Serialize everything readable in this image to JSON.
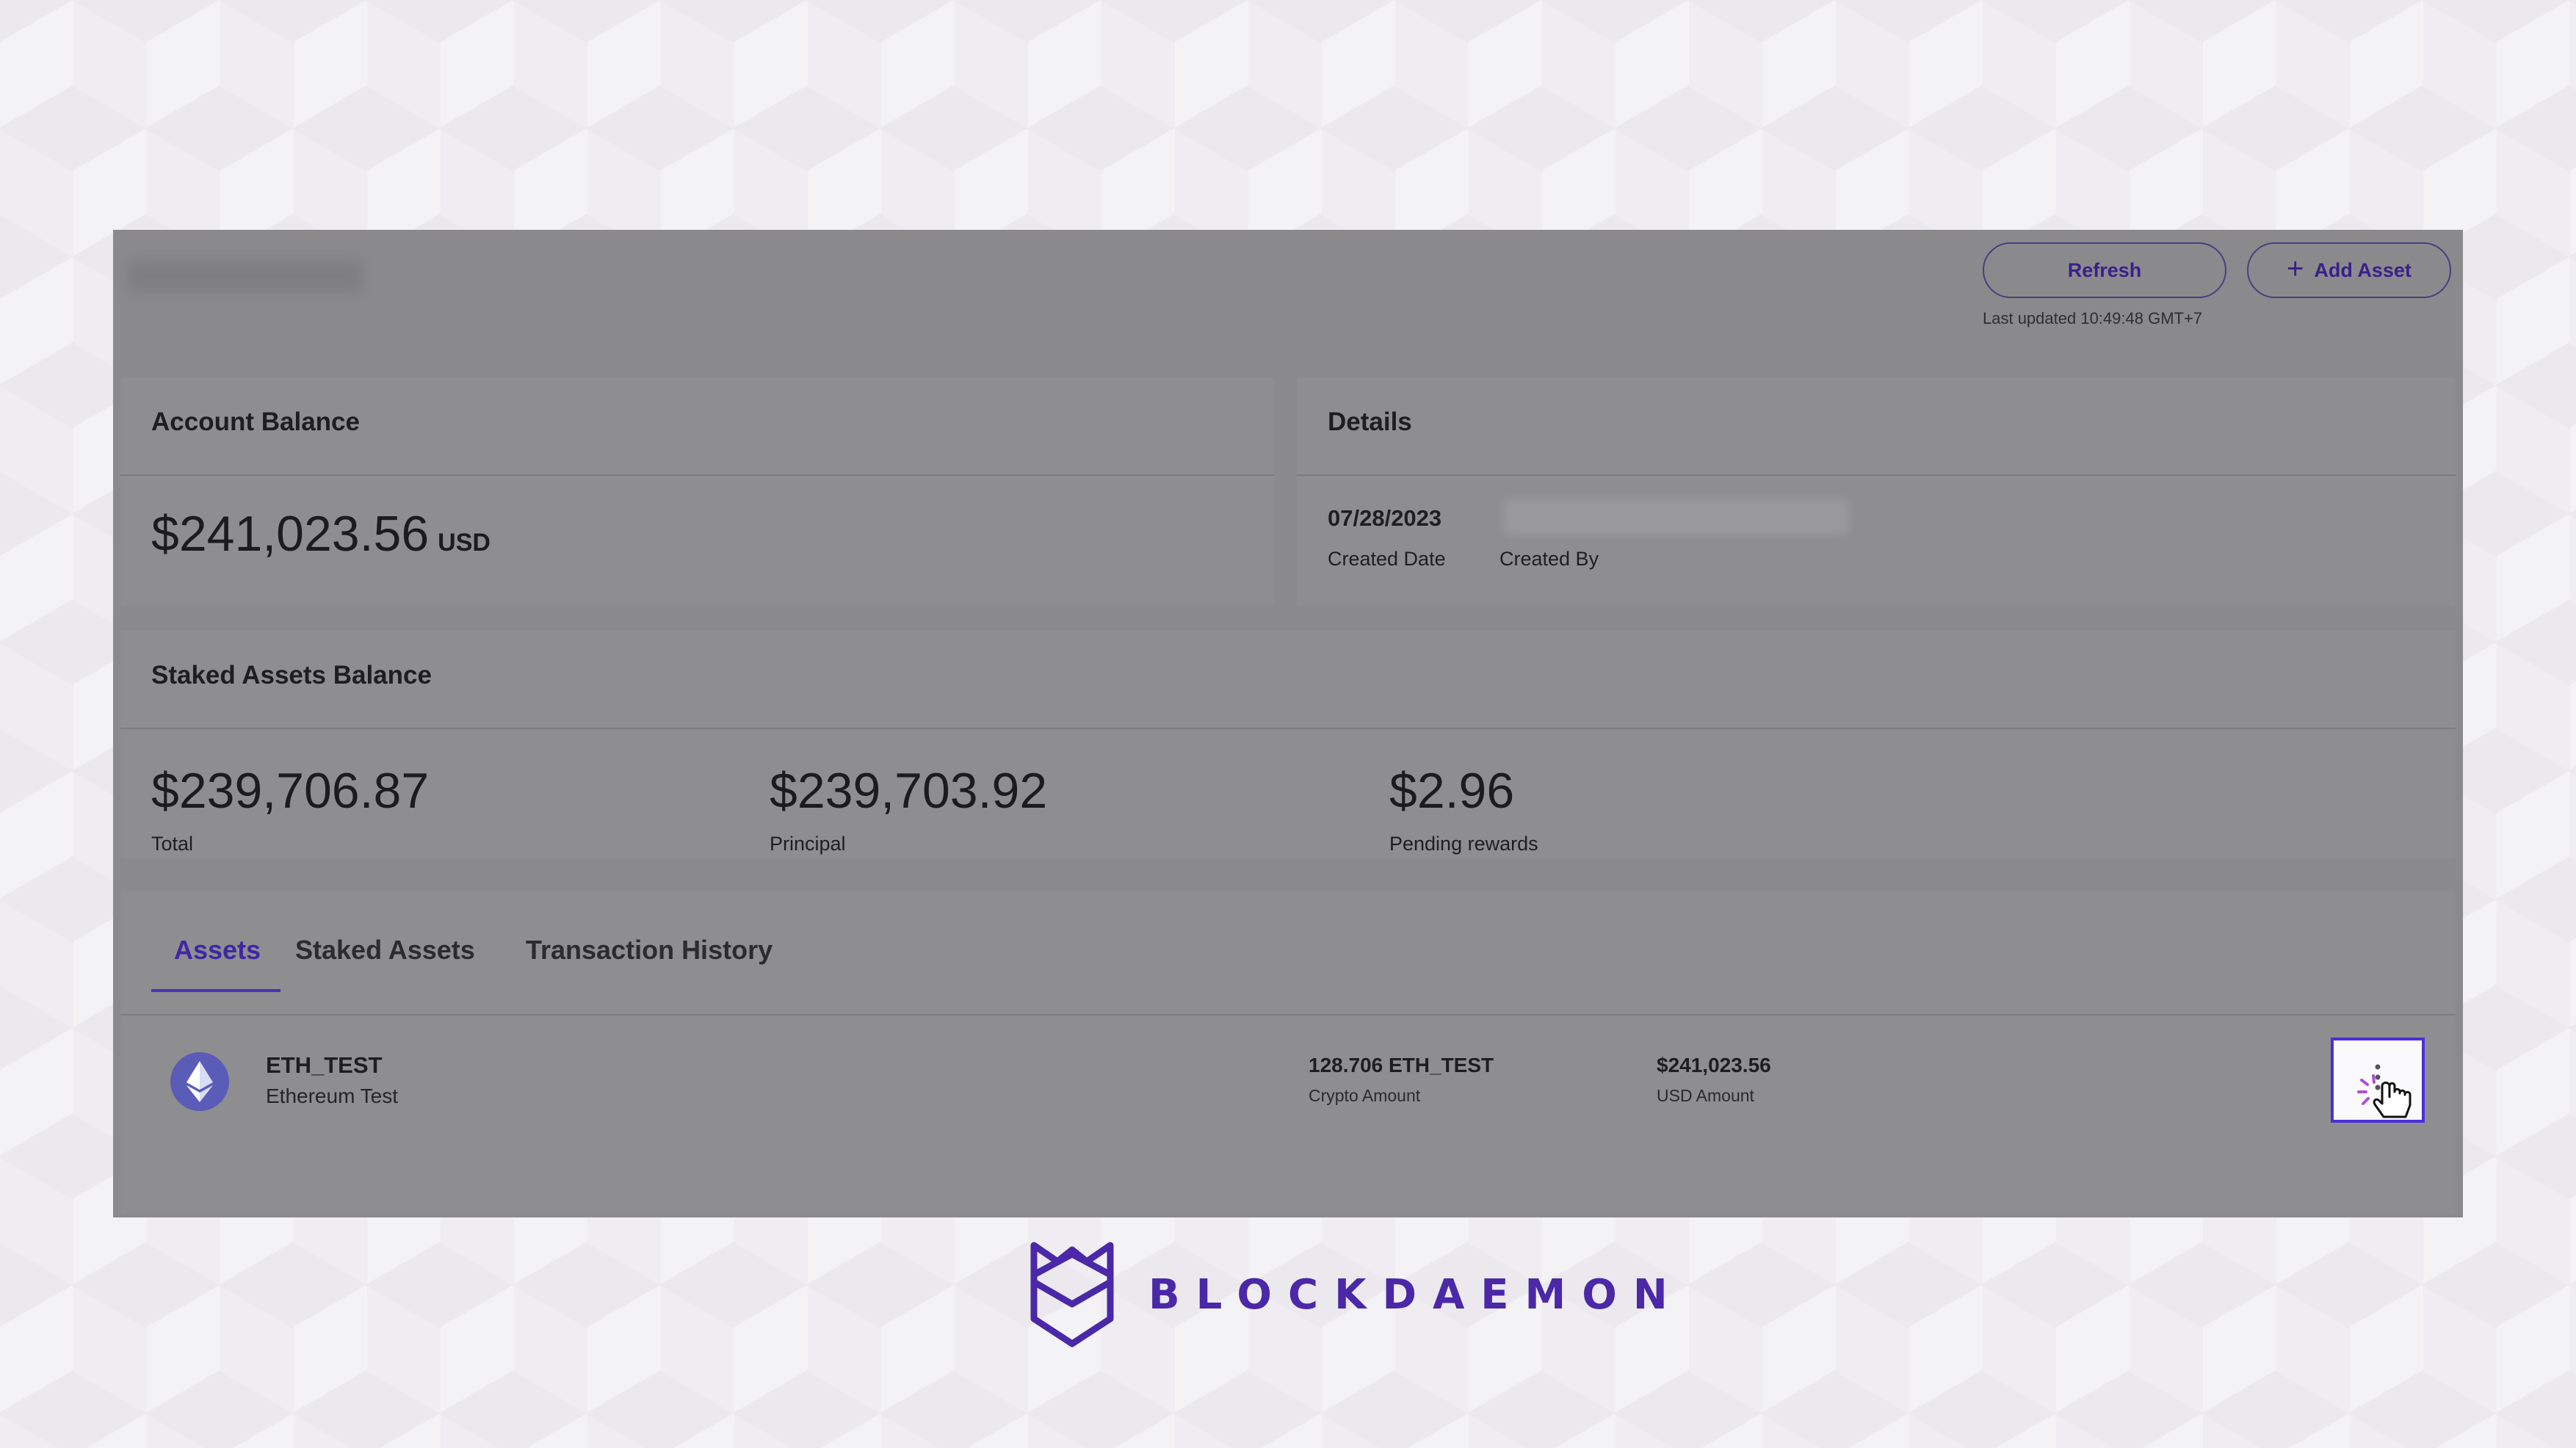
{
  "header": {
    "refresh_label": "Refresh",
    "add_asset_label": "Add Asset",
    "last_updated": "Last updated 10:49:48 GMT+7"
  },
  "account_balance": {
    "title": "Account Balance",
    "amount": "$241,023.56",
    "currency": "USD"
  },
  "details": {
    "title": "Details",
    "created_date_value": "07/28/2023",
    "created_date_label": "Created Date",
    "created_by_label": "Created By"
  },
  "staked_assets_balance": {
    "title": "Staked Assets Balance",
    "total_value": "$239,706.87",
    "total_label": "Total",
    "principal_value": "$239,703.92",
    "principal_label": "Principal",
    "pending_value": "$2.96",
    "pending_label": "Pending rewards"
  },
  "tabs": [
    {
      "label": "Assets",
      "active": true
    },
    {
      "label": "Staked Assets",
      "active": false
    },
    {
      "label": "Transaction History",
      "active": false
    }
  ],
  "asset_row": {
    "symbol": "ETH_TEST",
    "name": "Ethereum Test",
    "crypto_amount": "128.706 ETH_TEST",
    "crypto_amount_label": "Crypto Amount",
    "usd_amount": "$241,023.56",
    "usd_amount_label": "USD Amount",
    "icon": "ethereum-icon"
  },
  "brand": {
    "logo_text": "BLOCKDAEMON",
    "accent_color": "#4a28a8"
  }
}
